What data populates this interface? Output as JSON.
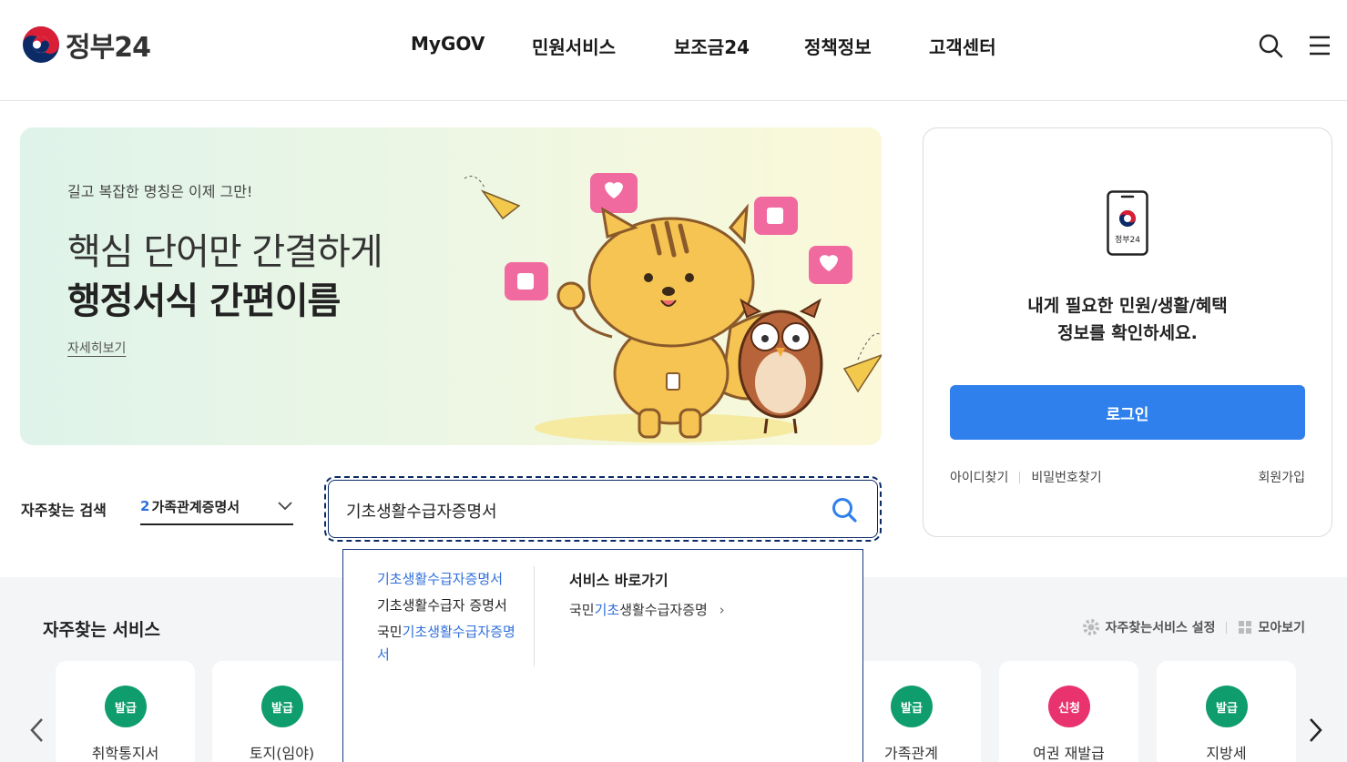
{
  "header": {
    "logo_text": "정부24",
    "nav": [
      "MyGOV",
      "민원서비스",
      "보조금24",
      "정책정보",
      "고객센터"
    ]
  },
  "banner": {
    "subtitle": "길고 복잡한 명칭은 이제 그만!",
    "title_line1": "핵심 단어만 간결하게",
    "title_line2": "행정서식 간편이름",
    "more_link": "자세히보기"
  },
  "login": {
    "phone_label": "정부24",
    "message_line1": "내게 필요한 민원/생활/혜택",
    "message_line2": "정보를 확인하세요.",
    "button": "로그인",
    "find_id": "아이디찾기",
    "find_pw": "비밀번호찾기",
    "join": "회원가입"
  },
  "search": {
    "frequent_label": "자주찾는 검색",
    "frequent_rank": "2",
    "frequent_value": "가족관계증명서",
    "input_value": "기초생활수급자증명서"
  },
  "autocomplete": {
    "items": [
      {
        "pre": "",
        "hl": "기초생활수급자증명서",
        "post": ""
      },
      {
        "pre": "기초생활수급자 증명서",
        "hl": "",
        "post": ""
      },
      {
        "pre": "국민",
        "hl": "기초생활수급자증명서",
        "post": ""
      }
    ],
    "shortcut_title": "서비스 바로가기",
    "shortcut_pre": "국민",
    "shortcut_hl": "기초",
    "shortcut_post": "생활수급자증명",
    "shortcut_arrow": "›"
  },
  "services": {
    "title": "자주찾는 서비스",
    "settings": "자주찾는서비스 설정",
    "view_all": "모아보기",
    "cards": [
      {
        "badge": "발급",
        "label": "취학통지서",
        "color": "green"
      },
      {
        "badge": "발급",
        "label": "토지(임야)",
        "color": "green"
      },
      {
        "badge": "발급",
        "label": "가족관계",
        "color": "green"
      },
      {
        "badge": "신청",
        "label": "여권 재발급",
        "color": "pink"
      },
      {
        "badge": "발급",
        "label": "지방세",
        "color": "green"
      }
    ]
  },
  "colors": {
    "primary": "#2f80ed",
    "issue_badge": "#0f9d6e",
    "apply_badge": "#e8336f",
    "search_border": "#0b2a66"
  }
}
